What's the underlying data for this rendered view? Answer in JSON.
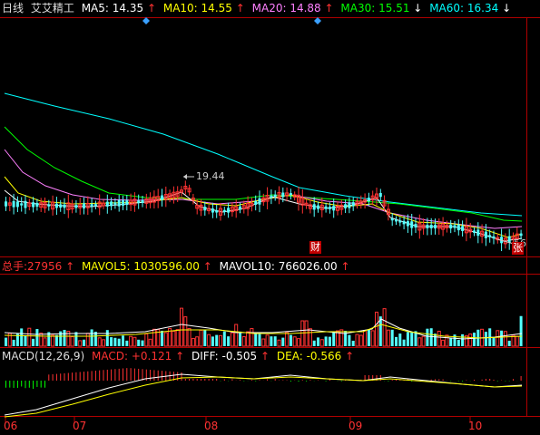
{
  "header": {
    "period": "日线",
    "stock_name": "艾艾精工",
    "ma": [
      {
        "label": "MA5:",
        "value": "14.35",
        "arrow": "↑",
        "color": "#ffffff"
      },
      {
        "label": "MA10:",
        "value": "14.55",
        "arrow": "↑",
        "color": "#ffff00"
      },
      {
        "label": "MA20:",
        "value": "14.88",
        "arrow": "↑",
        "color": "#ff80ff"
      },
      {
        "label": "MA30:",
        "value": "15.51",
        "arrow": "↓",
        "color": "#00ff00"
      },
      {
        "label": "MA60:",
        "value": "16.34",
        "arrow": "↓",
        "color": "#00ffff"
      }
    ]
  },
  "price_panel": {
    "high_label": "19.44",
    "low_label": "56",
    "marker_cai": "财",
    "marker_zhang": "张"
  },
  "volume_panel": {
    "total_label": "总手:",
    "total_value": "27956",
    "mavol5_label": "MAVOL5:",
    "mavol5_value": "1030596.00",
    "mavol10_label": "MAVOL10:",
    "mavol10_value": "766026.00",
    "arrow": "↑"
  },
  "macd_panel": {
    "title": "MACD(12,26,9)",
    "macd_label": "MACD:",
    "macd_value": "+0.121",
    "diff_label": "DIFF:",
    "diff_value": "-0.505",
    "dea_label": "DEA:",
    "dea_value": "-0.566",
    "arrow": "↑"
  },
  "x_axis": {
    "months": [
      "06",
      "07",
      "08",
      "09",
      "10"
    ]
  },
  "colors": {
    "up": "#ff3232",
    "down": "#54ffff",
    "axis": "#b00000",
    "ma5": "#ffffff",
    "ma10": "#ffff00",
    "ma20": "#ff80ff",
    "ma30": "#00ff00",
    "ma60": "#00ffff"
  }
}
